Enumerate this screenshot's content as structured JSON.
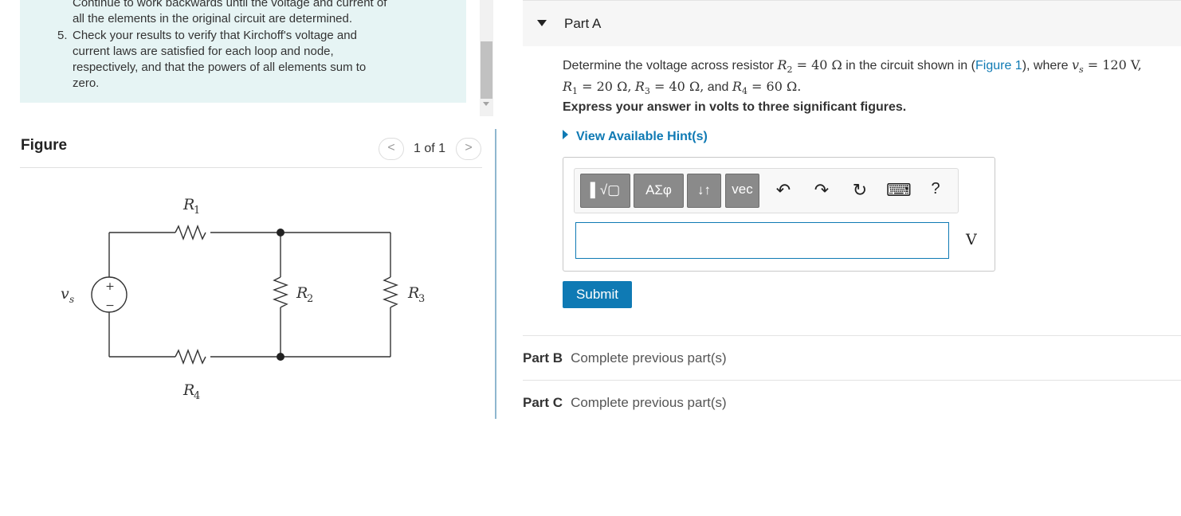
{
  "instructions": {
    "line1": "Continue to work backwards until the voltage and current of",
    "line2": "all the elements in the original circuit are determined.",
    "step5_number": "5.",
    "step5_lines": [
      "Check your results to verify that Kirchoff's voltage and",
      "current laws are satisfied for each loop and node,",
      "respectively, and that the powers of all elements sum to",
      "zero."
    ]
  },
  "figure": {
    "title": "Figure",
    "pager": {
      "prev": "<",
      "text": "1 of 1",
      "next": ">"
    },
    "labels": {
      "r1": "R",
      "r1_sub": "1",
      "r2": "R",
      "r2_sub": "2",
      "r3": "R",
      "r3_sub": "3",
      "r4": "R",
      "r4_sub": "4",
      "vs": "v",
      "vs_sub": "s",
      "plus": "+",
      "minus": "−"
    }
  },
  "partA": {
    "title": "Part A",
    "question": {
      "t1": "Determine the voltage across resistor ",
      "r2": "R",
      "r2_sub": "2",
      "r2_val": " = 40 Ω",
      "t2": " in the circuit shown in (",
      "figure_link": "Figure 1",
      "t3": "), where ",
      "vs": "v",
      "vs_sub": "s",
      "vs_val": " = 120 V,",
      "r1": "R",
      "r1_sub": "1",
      "r1_val": " = 20 Ω,",
      "r3": "R",
      "r3_sub": "3",
      "r3_val": " = 40 Ω,",
      "and": " and ",
      "r4": "R",
      "r4_sub": "4",
      "r4_val": " = 60 Ω."
    },
    "express": "Express your answer in volts to three significant figures.",
    "hint": "View Available Hint(s)",
    "toolbar": {
      "templates": "▌√▢",
      "greek": "ΑΣφ",
      "arrows": "↓↑",
      "vec": "vec",
      "undo": "↶",
      "redo": "↷",
      "reset": "↻",
      "keyboard": "⌨",
      "help": "?"
    },
    "answer": {
      "value": "",
      "unit": "V"
    },
    "submit": "Submit"
  },
  "partB": {
    "label": "Part B",
    "status": "Complete previous part(s)"
  },
  "partC": {
    "label": "Part C",
    "status": "Complete previous part(s)"
  }
}
